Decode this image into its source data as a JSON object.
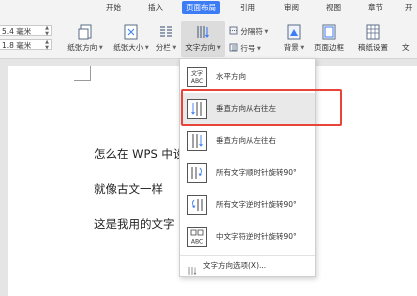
{
  "ribbon": {
    "tabs": [
      {
        "id": "start",
        "label": "开始"
      },
      {
        "id": "insert",
        "label": "插入"
      },
      {
        "id": "layout",
        "label": "页面布局",
        "active": true
      },
      {
        "id": "ref",
        "label": "引用"
      },
      {
        "id": "review",
        "label": "审阅"
      },
      {
        "id": "view",
        "label": "视图"
      },
      {
        "id": "chapter",
        "label": "章节"
      },
      {
        "id": "dev",
        "label": "开"
      }
    ],
    "margin_top": "5.4 毫米",
    "margin_bottom": "1.8 毫米",
    "buttons": {
      "orientation": "纸张方向",
      "size": "纸张大小",
      "columns": "分栏",
      "text_direction": "文字方向",
      "separator": "分隔符",
      "line_numbers": "行号",
      "background": "背景",
      "page_border": "页面边框",
      "manuscript": "稿纸设置",
      "more": "文"
    }
  },
  "document": {
    "lines": [
      "怎么在 WPS 中设",
      "就像古文一样",
      "这是我用的文字"
    ]
  },
  "text_direction_menu": {
    "items": [
      {
        "label": "水平方向",
        "icon": "horizontal-text-icon"
      },
      {
        "label": "垂直方向从右往左",
        "icon": "vertical-rtl-icon",
        "highlighted": true
      },
      {
        "label": "垂直方向从左往右",
        "icon": "vertical-ltr-icon"
      },
      {
        "label": "所有文字顺时针旋转90°",
        "icon": "rotate-cw-icon"
      },
      {
        "label": "所有文字逆时针旋转90°",
        "icon": "rotate-ccw-icon"
      },
      {
        "label": "中文字符逆时针旋转90°",
        "icon": "cjk-rotate-ccw-icon"
      }
    ],
    "footer": "文字方向选项(X)...",
    "icon_text": {
      "abc": "ABC",
      "wen": "文字"
    }
  },
  "colors": {
    "accent": "#3c7cf5",
    "highlight_box": "#e9443a"
  }
}
